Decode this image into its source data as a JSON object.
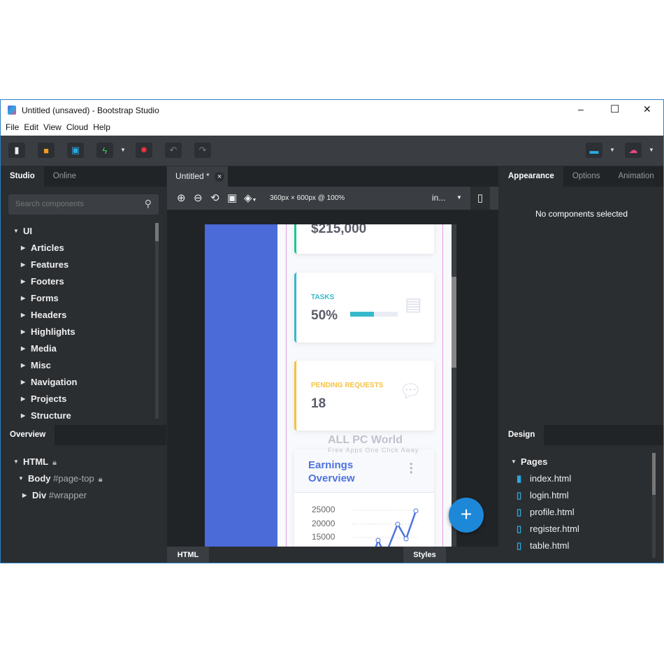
{
  "window": {
    "title": "Untitled (unsaved) - Bootstrap Studio",
    "minimize": "–",
    "maximize": "☐",
    "close": "✕"
  },
  "menu": [
    "File",
    "Edit",
    "View",
    "Cloud",
    "Help"
  ],
  "toolbar": {
    "icons": [
      "new-file-icon",
      "open-folder-icon",
      "save-icon",
      "preview-icon",
      "settings-icon",
      "undo-icon",
      "redo-icon",
      "export-icon",
      "publish-icon"
    ],
    "colors": {
      "folder": "#f59a23",
      "save": "#29a9e0",
      "preview": "#3ccf4e",
      "settings": "#e8353e",
      "publish": "#e8458b"
    }
  },
  "left": {
    "tabs": [
      "Studio",
      "Online"
    ],
    "search_placeholder": "Search components",
    "tree_root": "UI",
    "items": [
      "Articles",
      "Features",
      "Footers",
      "Forms",
      "Headers",
      "Highlights",
      "Media",
      "Misc",
      "Navigation",
      "Projects",
      "Structure"
    ],
    "overview_tab": "Overview",
    "overview": [
      {
        "tag": "HTML",
        "id": ""
      },
      {
        "tag": "Body",
        "id": "#page-top"
      },
      {
        "tag": "Div",
        "id": "#wrapper"
      }
    ]
  },
  "center": {
    "tab": "Untitled *",
    "tab_close": "×",
    "viewport": "360px × 600px @ 100%",
    "breakpoint": "in...",
    "cards": {
      "earnings_value": "$215,000",
      "tasks_label": "TASKS",
      "tasks_value": "50%",
      "tasks_progress": 50,
      "pending_label": "PENDING REQUESTS",
      "pending_value": "18"
    },
    "chart": {
      "title_line1": "Earnings",
      "title_line2": "Overview",
      "ticks": [
        "25000",
        "20000",
        "15000"
      ]
    },
    "watermark": {
      "name": "ALL PC World",
      "tagline": "Free Apps One Click Away"
    },
    "fab": "+",
    "bottom_tabs": [
      "HTML",
      "Styles"
    ]
  },
  "right": {
    "tabs": [
      "Appearance",
      "Options",
      "Animation"
    ],
    "empty": "No components selected",
    "design_tab": "Design",
    "pages_label": "Pages",
    "pages": [
      "index.html",
      "login.html",
      "profile.html",
      "register.html",
      "table.html"
    ]
  }
}
